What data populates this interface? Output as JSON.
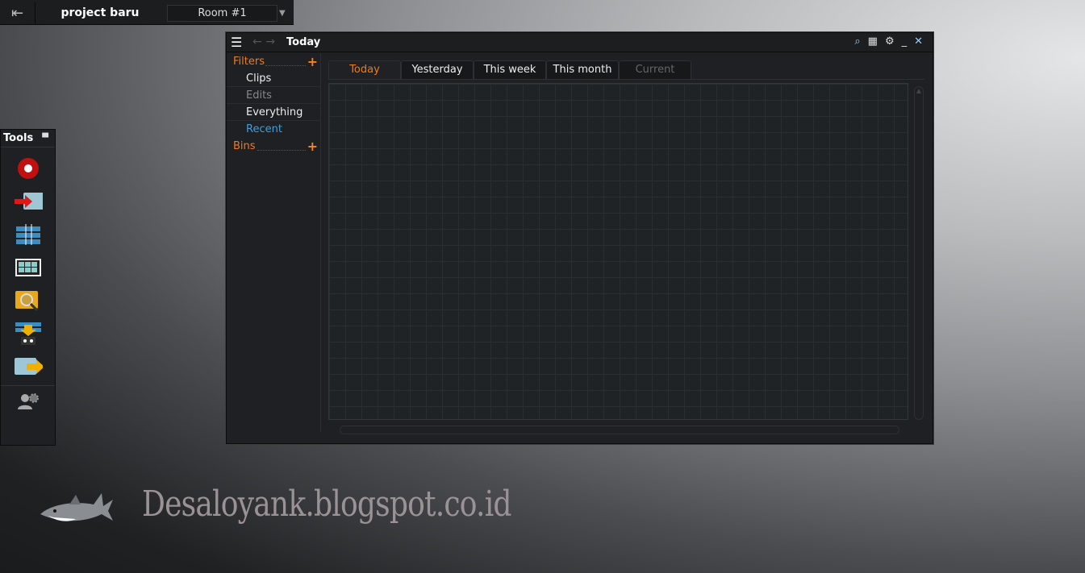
{
  "topbar": {
    "project": "project baru",
    "room": "Room #1"
  },
  "window": {
    "title": "Today"
  },
  "sidebar": {
    "filters_label": "Filters",
    "items": [
      "Clips",
      "Edits",
      "Everything",
      "Recent"
    ],
    "bins_label": "Bins"
  },
  "tabs": [
    "Today",
    "Yesterday",
    "This week",
    "This month",
    "Current"
  ],
  "tools": {
    "title": "Tools"
  },
  "watermark": "Desaloyank.blogspot.co.id",
  "colors": {
    "accent": "#f07a1e",
    "recent": "#3aa0e0"
  }
}
